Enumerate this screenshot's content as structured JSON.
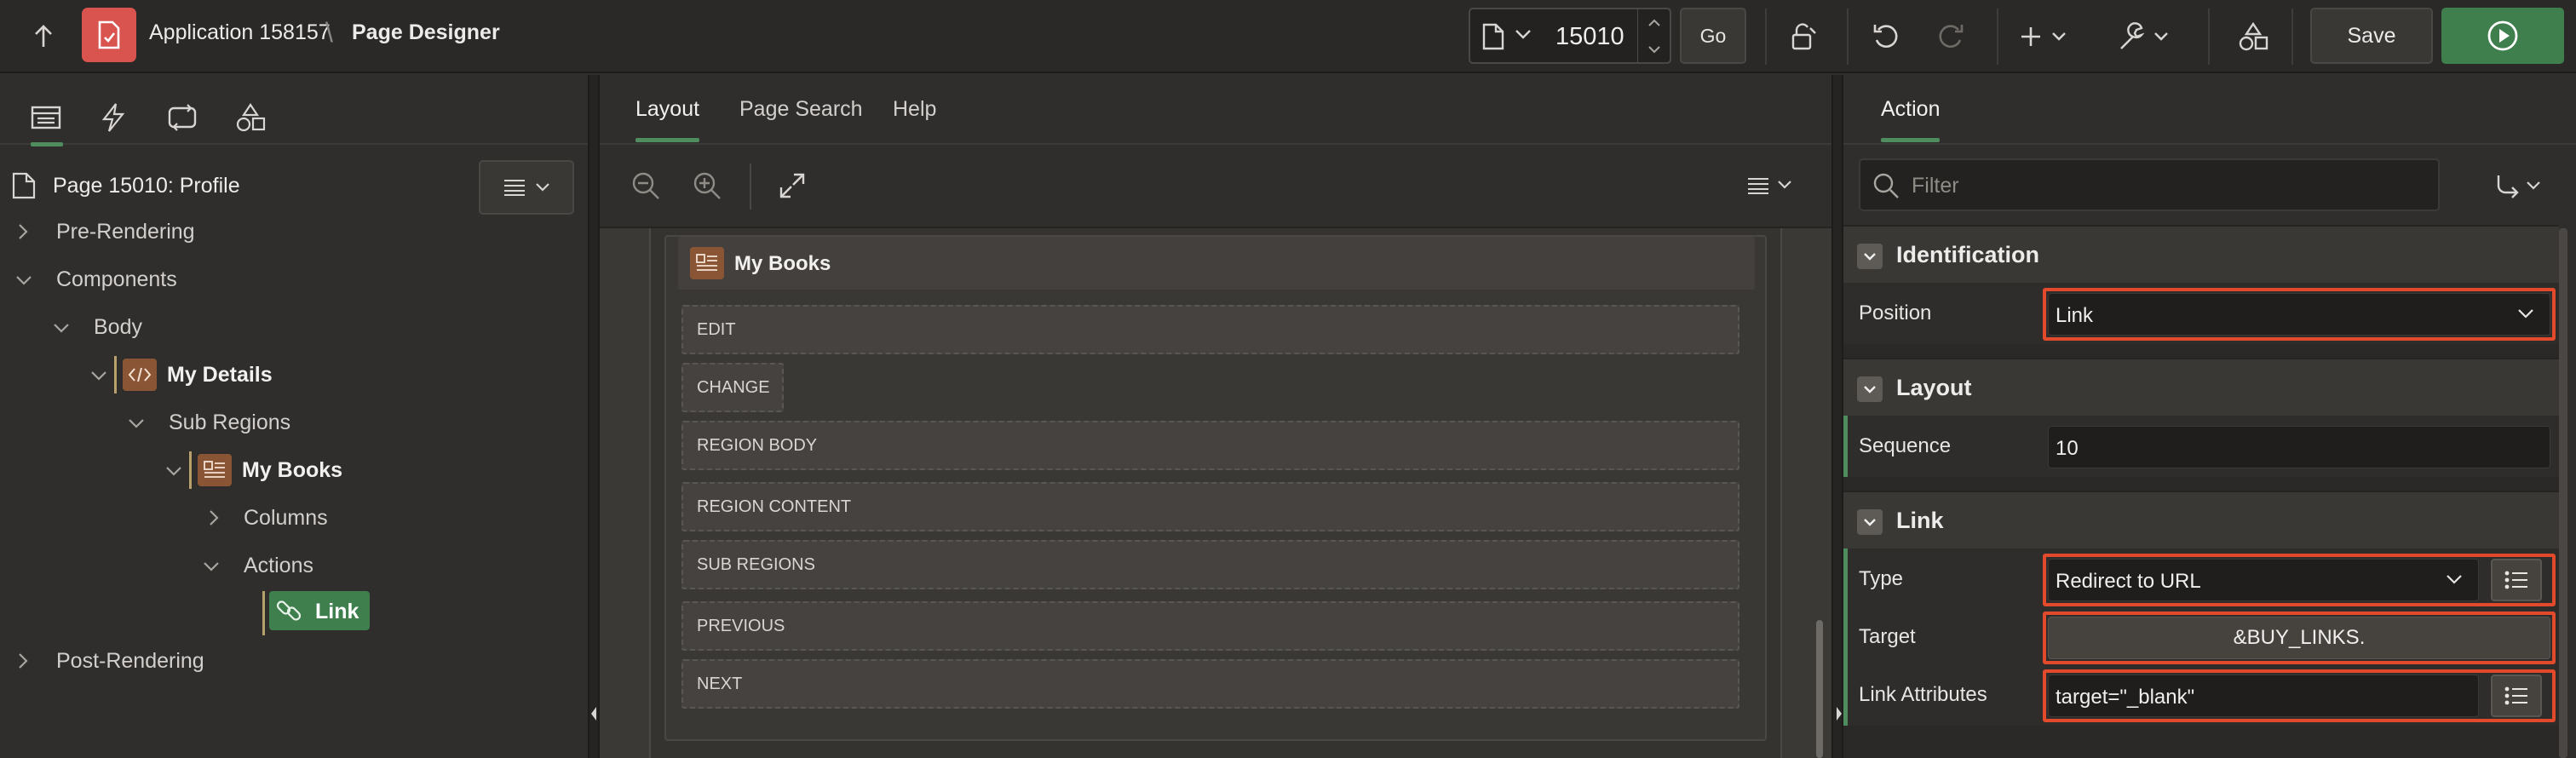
{
  "header": {
    "app_title": "Application 158157",
    "separator": "\\",
    "page_title": "Page Designer",
    "page_number": "15010",
    "go_label": "Go",
    "save_label": "Save"
  },
  "left_panel": {
    "tabs": [
      "rendering-tab",
      "dynamic-actions-tab",
      "processing-tab",
      "shared-components-tab"
    ],
    "page_node": "Page 15010: Profile",
    "tree": {
      "pre_rendering": "Pre-Rendering",
      "components": "Components",
      "body": "Body",
      "my_details": "My Details",
      "sub_regions": "Sub Regions",
      "my_books": "My Books",
      "columns": "Columns",
      "actions": "Actions",
      "link": "Link",
      "post_rendering": "Post-Rendering"
    }
  },
  "center_panel": {
    "tabs": {
      "layout": "Layout",
      "page_search": "Page Search",
      "help": "Help"
    },
    "region_title": "My Books",
    "slots": [
      "EDIT",
      "CHANGE",
      "REGION BODY",
      "REGION CONTENT",
      "SUB REGIONS",
      "PREVIOUS",
      "NEXT"
    ]
  },
  "right_panel": {
    "tab": "Action",
    "filter_placeholder": "Filter",
    "groups": {
      "identification": "Identification",
      "layout": "Layout",
      "link": "Link"
    },
    "props": {
      "position_label": "Position",
      "position_value": "Link",
      "sequence_label": "Sequence",
      "sequence_value": "10",
      "type_label": "Type",
      "type_value": "Redirect to URL",
      "target_label": "Target",
      "target_value": "&BUY_LINKS.",
      "link_attributes_label": "Link Attributes",
      "link_attributes_value": "target=\"_blank\""
    }
  },
  "colors": {
    "accent_green": "#4f8d5e",
    "run_button": "#3f7f4e",
    "app_badge": "#d9534f",
    "highlight_red": "#e24a2b",
    "region_icon": "#8a5535"
  }
}
